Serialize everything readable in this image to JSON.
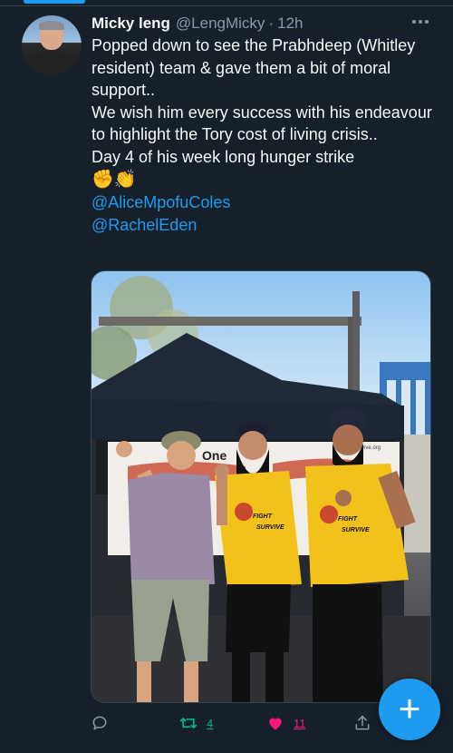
{
  "tweet": {
    "author_name": "Micky leng",
    "author_handle": "@LengMicky",
    "separator": "·",
    "time": "12h",
    "lines": [
      "Popped down to see the Prabhdeep (Whitley resident) team & gave them a bit of moral support..",
      "We wish him every success with his endeavour to highlight the Tory cost of living crisis..",
      "Day 4 of his week long hunger strike"
    ],
    "emojis": "✊👏",
    "mentions": [
      "@AliceMpofuColes",
      "@RachelEden"
    ]
  },
  "photo": {
    "banner_text": "One",
    "shirt_text_1": "FIGHT",
    "shirt_text_2": "SURVIVE",
    "sign_small": "vive.org"
  },
  "actions": {
    "retweets": "4",
    "likes": "11"
  },
  "colors": {
    "background": "#15202b",
    "accent": "#1d9bf0",
    "retweet": "#00ba7c",
    "like": "#f91880",
    "muted": "#8b98a5"
  },
  "icons": {
    "reply": "reply-icon",
    "retweet": "retweet-icon",
    "like": "heart-icon",
    "share": "share-icon",
    "more": "more-icon",
    "compose": "plus-icon"
  },
  "compose_symbol": "+"
}
